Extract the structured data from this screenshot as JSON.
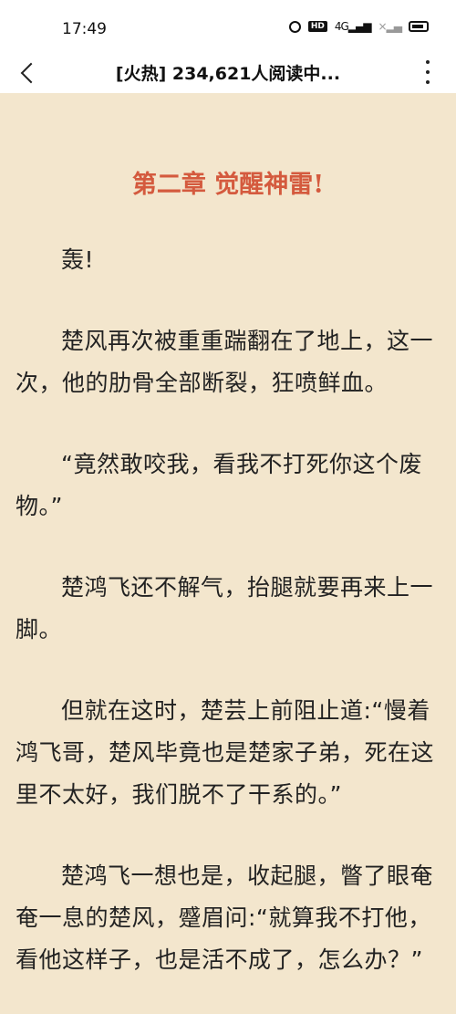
{
  "status_bar": {
    "time": "17:49",
    "hd_label": "HD",
    "network_label": "4G"
  },
  "header": {
    "title": "[火热] 234,621人阅读中..."
  },
  "chapter": {
    "title": "第二章   觉醒神雷!",
    "paragraphs": [
      "轰!",
      "楚风再次被重重踹翻在了地上，这一次，他的肋骨全部断裂，狂喷鲜血。",
      "“竟然敢咬我，看我不打死你这个废物。”",
      "楚鸿飞还不解气，抬腿就要再来上一脚。",
      "但就在这时，楚芸上前阻止道:“慢着鸿飞哥，楚风毕竟也是楚家子弟，死在这里不太好，我们脱不了干系的。”",
      "楚鸿飞一想也是，收起腿，瞥了眼奄奄一息的楚风，蹙眉问:“就算我不打他，看他这样子，也是活不成了，怎么办？”"
    ]
  },
  "colors": {
    "page_background": "#f3e6cd",
    "chapter_title": "#d45a3e",
    "text": "#222222"
  }
}
